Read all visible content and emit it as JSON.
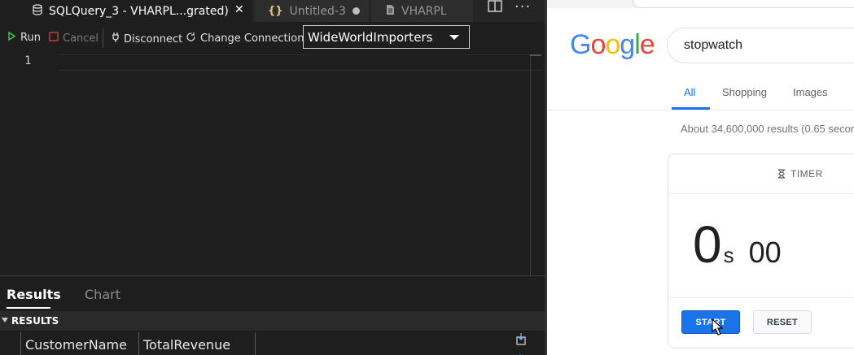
{
  "editor": {
    "tabs": [
      {
        "label": "SQLQuery_3 - VHARPL...grated)",
        "close": "✕"
      },
      {
        "label": "Untitled-3"
      },
      {
        "label": "VHARPL"
      }
    ],
    "more": "···",
    "toolbar": {
      "run": "Run",
      "cancel": "Cancel",
      "disconnect": "Disconnect",
      "change_connection": "Change Connection",
      "database": "WideWorldImporters"
    },
    "line_number": "1",
    "results_tabs": {
      "results": "Results",
      "chart": "Chart"
    },
    "results_section": "RESULTS",
    "columns": [
      "CustomerName",
      "TotalRevenue"
    ]
  },
  "browser": {
    "logo": [
      "G",
      "o",
      "o",
      "g",
      "l",
      "e"
    ],
    "logo_colors": [
      "#4285f4",
      "#ea4335",
      "#fbbc05",
      "#4285f4",
      "#34a853",
      "#ea4335"
    ],
    "search_query": "stopwatch",
    "nav": {
      "all": "All",
      "shopping": "Shopping",
      "images": "Images"
    },
    "stats": "About 34,600,000 results (0.65 secor",
    "stopwatch": {
      "tab": "TIMER",
      "seconds": "0",
      "seconds_unit": "s",
      "centiseconds": "00",
      "start": "START",
      "reset": "RESET"
    },
    "accent": "#1a73e8"
  }
}
